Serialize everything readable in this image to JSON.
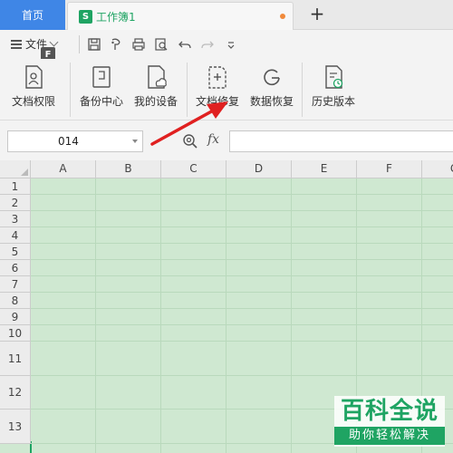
{
  "tabs": {
    "home": "首页",
    "document": "工作簿1",
    "doc_icon_letter": "S",
    "add": "+"
  },
  "quickbar": {
    "menu_label": "文件",
    "shortcut_badge": "F"
  },
  "ribbon": {
    "items": [
      {
        "label": "文档权限",
        "icon": "doc-permission-icon"
      },
      {
        "label": "备份中心",
        "icon": "backup-center-icon"
      },
      {
        "label": "我的设备",
        "icon": "my-device-icon"
      },
      {
        "label": "文档修复",
        "icon": "doc-repair-icon"
      },
      {
        "label": "数据恢复",
        "icon": "data-recovery-icon"
      },
      {
        "label": "历史版本",
        "icon": "history-version-icon"
      }
    ]
  },
  "formula_bar": {
    "cell_reference": "014",
    "fx": "fx",
    "formula_value": ""
  },
  "sheet": {
    "columns": [
      "A",
      "B",
      "C",
      "D",
      "E",
      "F",
      "G"
    ],
    "rows": [
      "1",
      "2",
      "3",
      "4",
      "5",
      "6",
      "7",
      "8",
      "9",
      "10",
      "11",
      "12",
      "13"
    ]
  },
  "watermark": {
    "title": "百科全说",
    "subtitle": "助你轻松解决"
  },
  "colors": {
    "accent_blue": "#3f86e6",
    "brand_green": "#1fa463",
    "cell_fill": "#cfe8d1",
    "annotation_arrow": "#e02020"
  }
}
